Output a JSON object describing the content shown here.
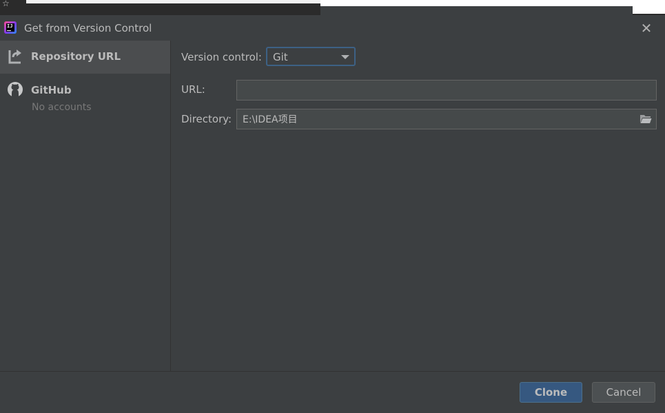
{
  "dialog": {
    "title": "Get from Version Control",
    "close_icon": "close-icon"
  },
  "sidebar": {
    "items": [
      {
        "label": "Repository URL",
        "icon": "repository-url-icon",
        "selected": true
      },
      {
        "label": "GitHub",
        "sublabel": "No accounts",
        "icon": "github-icon",
        "selected": false
      }
    ]
  },
  "form": {
    "version_control_label": "Version control:",
    "version_control_value": "Git",
    "url_label": "URL:",
    "url_value": "",
    "directory_label": "Directory:",
    "directory_value": "E:\\IDEA项目",
    "browse_icon": "folder-icon"
  },
  "footer": {
    "clone_label": "Clone",
    "cancel_label": "Cancel"
  },
  "colors": {
    "background": "#3c3f41",
    "selected_item": "#4b4d4f",
    "primary_button": "#365880",
    "focus_border": "#3d6185"
  }
}
